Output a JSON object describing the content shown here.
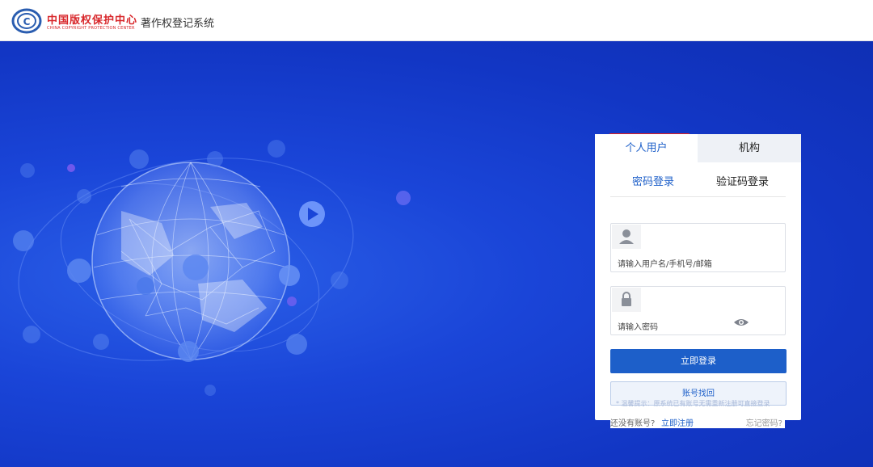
{
  "header": {
    "logo_cn": "中国版权保护中心",
    "logo_en": "CHINA COPYRIGHT PROTECTION CENTER",
    "system_title": "著作权登记系统"
  },
  "login": {
    "tabs": [
      "个人用户",
      "机构"
    ],
    "subtabs": [
      "密码登录",
      "验证码登录"
    ],
    "username_placeholder": "请输入用户名/手机号/邮箱",
    "password_placeholder": "请输入密码",
    "login_button": "立即登录",
    "recover_button": "账号找回",
    "notice": "* 温馨提示：原系统已有账号无需重新注册可直接登录",
    "no_account": "还没有账号?",
    "register": "立即注册",
    "forgot": "忘记密码?"
  },
  "colors": {
    "accent": "#1d5fc9",
    "highlight": "#e02020",
    "background": "#1a45d8"
  }
}
